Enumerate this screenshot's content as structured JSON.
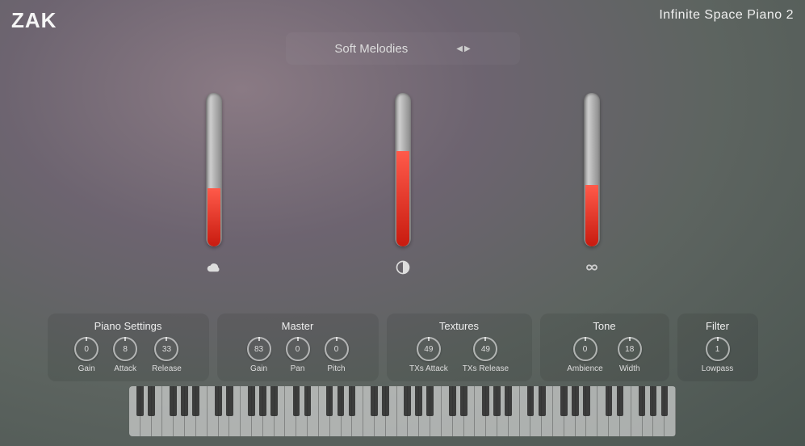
{
  "brand": "ZAK",
  "product": "Infinite Space Piano 2",
  "preset": {
    "name": "Soft Melodies"
  },
  "meters": [
    {
      "icon": "cloud-icon",
      "fill_pct": 38
    },
    {
      "icon": "contrast-icon",
      "fill_pct": 62
    },
    {
      "icon": "infinity-icon",
      "fill_pct": 40
    }
  ],
  "panels": {
    "piano": {
      "title": "Piano Settings",
      "knobs": [
        {
          "label": "Gain",
          "value": "0"
        },
        {
          "label": "Attack",
          "value": "8"
        },
        {
          "label": "Release",
          "value": "33"
        }
      ]
    },
    "master": {
      "title": "Master",
      "knobs": [
        {
          "label": "Gain",
          "value": "83"
        },
        {
          "label": "Pan",
          "value": "0"
        },
        {
          "label": "Pitch",
          "value": "0"
        }
      ]
    },
    "textures": {
      "title": "Textures",
      "knobs": [
        {
          "label": "TXs Attack",
          "value": "49"
        },
        {
          "label": "TXs Release",
          "value": "49"
        }
      ]
    },
    "tone": {
      "title": "Tone",
      "knobs": [
        {
          "label": "Ambience",
          "value": "0"
        },
        {
          "label": "Width",
          "value": "18"
        }
      ]
    },
    "filter": {
      "title": "Filter",
      "knobs": [
        {
          "label": "Lowpass",
          "value": "1"
        }
      ]
    }
  }
}
